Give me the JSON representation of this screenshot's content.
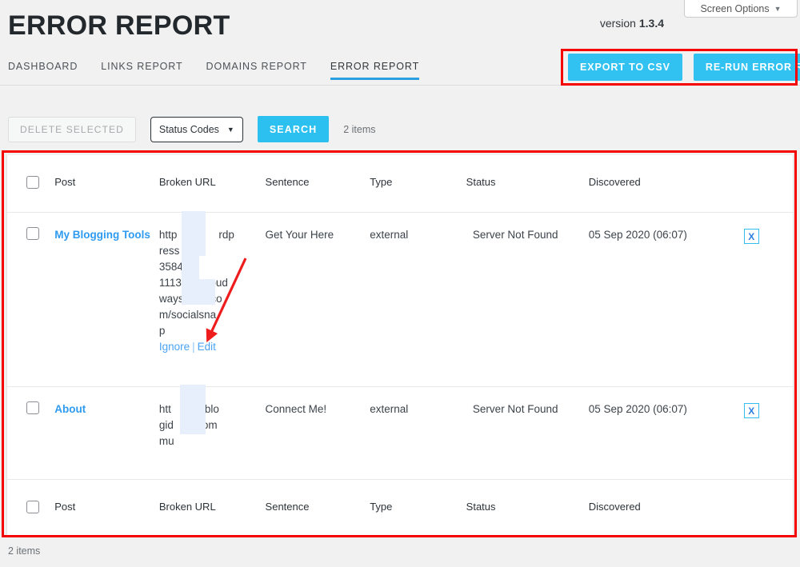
{
  "screen_options": {
    "label": "Screen Options",
    "caret": "▼"
  },
  "header": {
    "title": "ERROR REPORT",
    "version_label": "version",
    "version_number": "1.3.4"
  },
  "nav": {
    "tabs": [
      {
        "label": "DASHBOARD",
        "active": false
      },
      {
        "label": "LINKS REPORT",
        "active": false
      },
      {
        "label": "DOMAINS REPORT",
        "active": false
      },
      {
        "label": "ERROR REPORT",
        "active": true
      }
    ]
  },
  "actions": {
    "export_csv": "EXPORT TO CSV",
    "rerun_report": "RE-RUN ERROR REPORT"
  },
  "toolbar": {
    "delete_selected": "DELETE SELECTED",
    "status_filter": "Status Codes",
    "status_filter_caret": "▼",
    "search": "SEARCH",
    "items_count": "2 items"
  },
  "table": {
    "columns": [
      "",
      "Post",
      "Broken URL",
      "Sentence",
      "Type",
      "Status",
      "Discovered",
      ""
    ],
    "headers": {
      "post": "Post",
      "broken_url": "Broken URL",
      "sentence": "Sentence",
      "type": "Type",
      "status": "Status",
      "discovered": "Discovered"
    },
    "rows": [
      {
        "post": "My Blogging Tools",
        "url_lines": [
          "http",
          "ress",
          "3584",
          "11135",
          "ways",
          "m/socialsna",
          "p"
        ],
        "url_lines_tail": [
          "rdp",
          "",
          "",
          "oud",
          ".co",
          "",
          ""
        ],
        "url_text": "http[redacted]rdp ress[redacted] 3584[redacted] 11135[redacted]oud ways[redacted].com/socialsnap",
        "ignore_label": "Ignore",
        "edit_label": "Edit",
        "sentence": "Get Your Here",
        "type": "external",
        "status": "Server Not Found",
        "discovered": "05 Sep 2020 (06:07)",
        "remove_label": "X"
      },
      {
        "post": "About",
        "url_lines": [
          "htt",
          "gid",
          "mu"
        ],
        "url_lines_tail": [
          "llblo",
          "om",
          ""
        ],
        "url_text": "htt[redacted]llblogid[redacted]om mu[redacted]",
        "ignore_label": "",
        "edit_label": "",
        "sentence": "Connect Me!",
        "type": "external",
        "status": "Server Not Found",
        "discovered": "05 Sep 2020 (06:07)",
        "remove_label": "X"
      }
    ]
  },
  "footer": {
    "items_count": "2 items"
  },
  "colors": {
    "accent_cyan": "#32c2f2",
    "link_blue": "#2f9bf0",
    "tab_underline": "#2b9fe0",
    "annotation_red": "#f40000",
    "redaction": "#e7eefc",
    "page_bg": "#f1f1f1"
  }
}
